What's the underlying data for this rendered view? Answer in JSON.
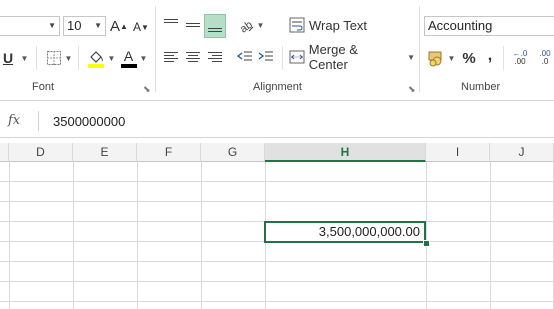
{
  "ribbon": {
    "font": {
      "size_value": "10",
      "underline_label": "U",
      "group_label": "Font",
      "grow_label": "A",
      "shrink_label": "A",
      "font_color_label": "A"
    },
    "alignment": {
      "wrap_text_label": "Wrap Text",
      "merge_center_label": "Merge & Center",
      "group_label": "Alignment"
    },
    "number": {
      "format_value": "Accounting",
      "percent_label": "%",
      "comma_label": ",",
      "group_label": "Number",
      "increase_decimal_label": ".00",
      "decrease_decimal_label": ".0"
    },
    "colors": {
      "accent": "#217346",
      "highlight": "#ffff00",
      "font_color": "#000000",
      "selected_button": "#b6dec7"
    }
  },
  "formula_bar": {
    "fx_label": "fx",
    "value": "3500000000"
  },
  "columns": [
    "D",
    "E",
    "F",
    "G",
    "H",
    "I",
    "J"
  ],
  "selected_column": "H",
  "active_cell": {
    "display_value": "3,500,000,000.00"
  }
}
